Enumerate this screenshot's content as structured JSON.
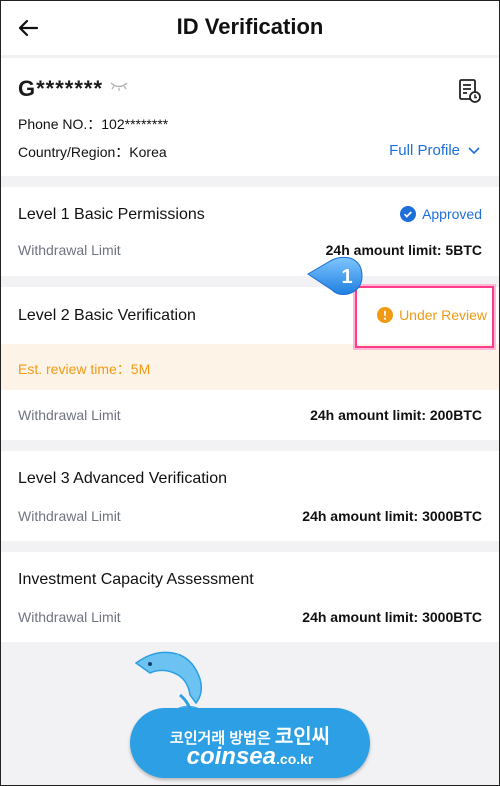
{
  "header": {
    "title": "ID Verification"
  },
  "profile": {
    "username": "G*******",
    "phone_label": "Phone NO.：",
    "phone_value": "102********",
    "country_label": "Country/Region：",
    "country_value": "Korea",
    "full_profile": "Full Profile"
  },
  "levels": [
    {
      "title": "Level 1 Basic Permissions",
      "status": "Approved",
      "limit_label": "Withdrawal Limit",
      "limit_value": "24h amount limit: 5BTC"
    },
    {
      "title": "Level 2 Basic Verification",
      "status": "Under Review",
      "est_text": "Est. review time：5M",
      "limit_label": "Withdrawal Limit",
      "limit_value": "24h amount limit: 200BTC"
    },
    {
      "title": "Level 3 Advanced Verification",
      "limit_label": "Withdrawal Limit",
      "limit_value": "24h amount limit: 3000BTC"
    },
    {
      "title": "Investment Capacity Assessment",
      "limit_label": "Withdrawal Limit",
      "limit_value": "24h amount limit: 3000BTC"
    }
  ],
  "marker": {
    "number": "1"
  },
  "watermark": {
    "korean": "코인거래 방법은",
    "korean_big": "코인씨",
    "site": "coinsea",
    "tld": ".co.kr"
  },
  "colors": {
    "accent": "#1e6fd9",
    "warning": "#f29a14",
    "highlight": "#ff3d8a"
  }
}
